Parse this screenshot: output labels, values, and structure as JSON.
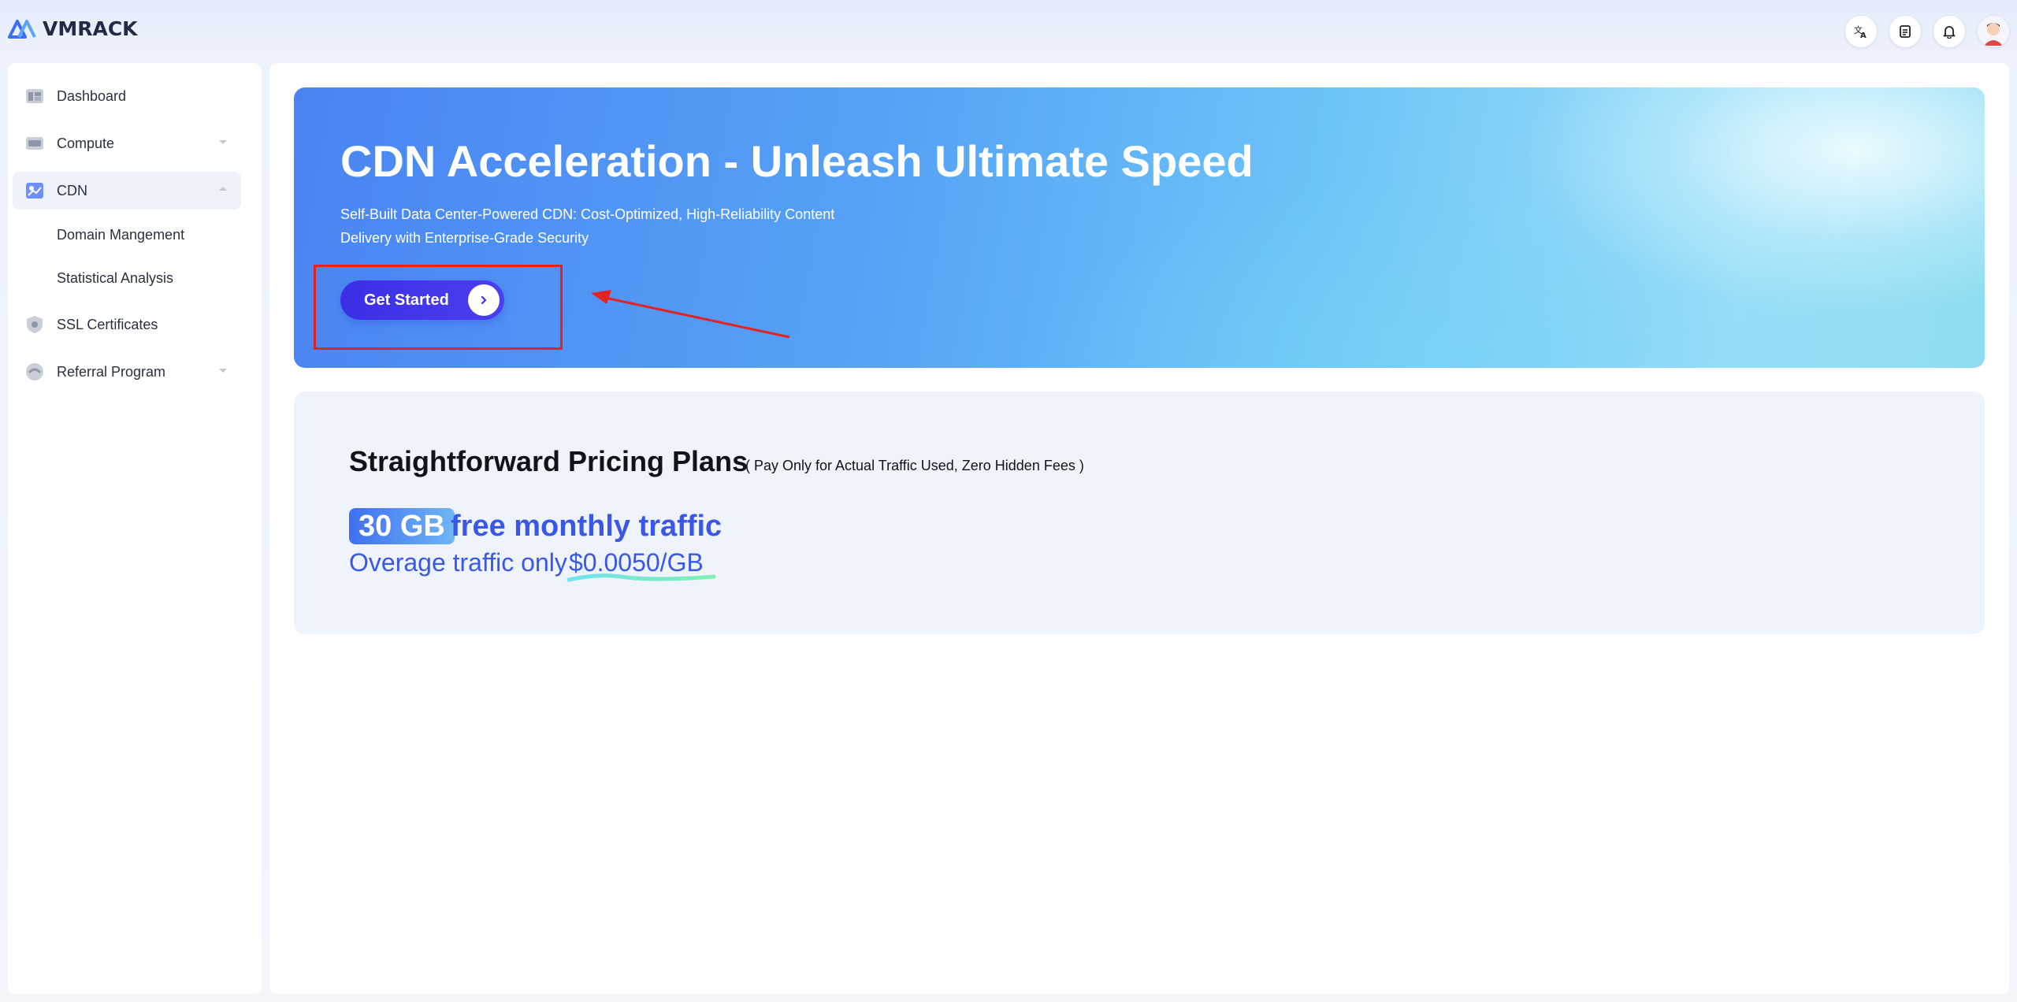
{
  "brand": {
    "name": "VMRACK"
  },
  "topbar": {
    "icons": [
      "translate-icon",
      "document-icon",
      "bell-icon",
      "user-avatar"
    ]
  },
  "sidebar": {
    "items": [
      {
        "label": "Dashboard",
        "icon": "dashboard-icon"
      },
      {
        "label": "Compute",
        "icon": "compute-icon",
        "expandable": true,
        "expanded": false
      },
      {
        "label": "CDN",
        "icon": "cdn-icon",
        "expandable": true,
        "expanded": true,
        "active": true
      },
      {
        "label": "SSL Certificates",
        "icon": "shield-icon"
      },
      {
        "label": "Referral Program",
        "icon": "referral-icon",
        "expandable": true,
        "expanded": false
      }
    ],
    "cdn_children": [
      "Domain Mangement",
      "Statistical Analysis"
    ]
  },
  "hero": {
    "title": "CDN Acceleration - Unleash Ultimate Speed",
    "subtitle_line1": "Self-Built Data Center-Powered CDN: Cost-Optimized, High-Reliability Content",
    "subtitle_line2": "Delivery with Enterprise-Grade Security",
    "cta_label": "Get Started",
    "annotation_color": "#e32222"
  },
  "pricing": {
    "title": "Straightforward Pricing Plans",
    "note": "( Pay Only for Actual Traffic Used, Zero Hidden Fees )",
    "free_amount": "30 GB",
    "free_text": "free monthly traffic",
    "overage_text": "Overage traffic only",
    "overage_price": "$0.0050/GB"
  },
  "colors": {
    "accent": "#3a58e6",
    "cta": "#3a2ee6",
    "highlight": "#e32222"
  }
}
